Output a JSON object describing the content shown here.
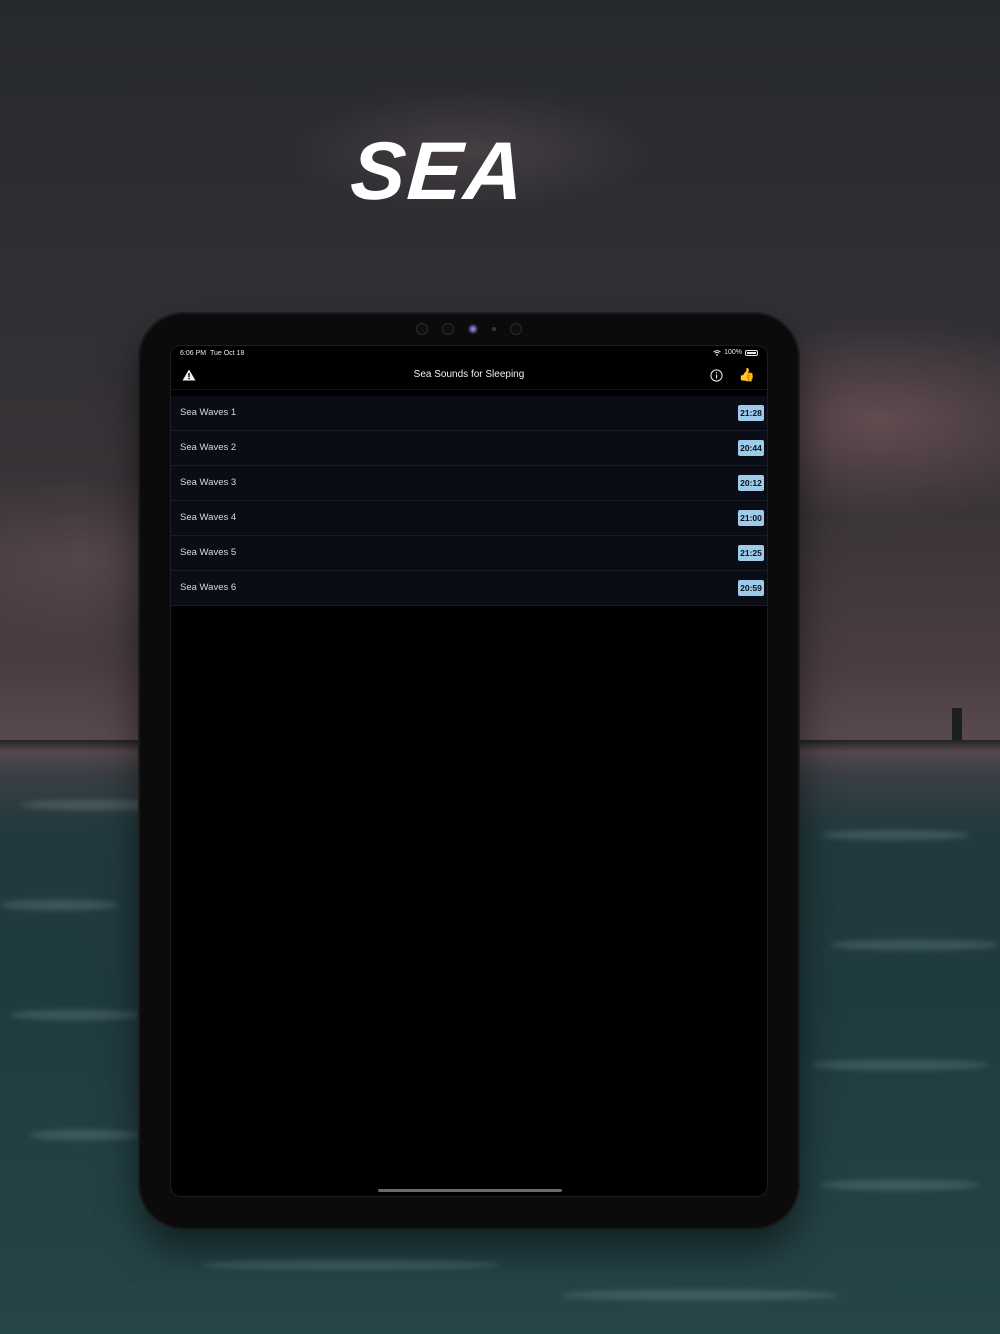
{
  "logo": {
    "text": "SEA"
  },
  "status_bar": {
    "time": "6:06 PM",
    "date": "Tue Oct 18",
    "battery": "100%"
  },
  "nav": {
    "title": "Sea Sounds for Sleeping",
    "left_icon": "warning-icon",
    "right_icons": [
      "info-icon",
      "thumbs-up-icon"
    ]
  },
  "tracks": [
    {
      "label": "Sea Waves 1",
      "duration": "21:28"
    },
    {
      "label": "Sea Waves 2",
      "duration": "20:44"
    },
    {
      "label": "Sea Waves 3",
      "duration": "20:12"
    },
    {
      "label": "Sea Waves 4",
      "duration": "21:00"
    },
    {
      "label": "Sea Waves 5",
      "duration": "21:25"
    },
    {
      "label": "Sea Waves 6",
      "duration": "20:59"
    }
  ],
  "colors": {
    "badge_bg": "#9ecbea",
    "row_bg": "#0a0c16",
    "screen_bg": "#000000"
  }
}
